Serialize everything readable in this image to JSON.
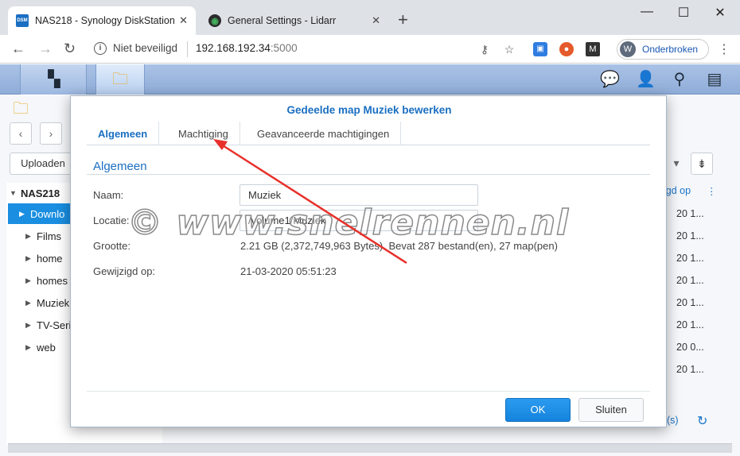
{
  "browser": {
    "tabs": [
      {
        "title": "NAS218 - Synology DiskStation",
        "favicon": "DSM"
      },
      {
        "title": "General Settings - Lidarr"
      }
    ],
    "new_tab": "+",
    "window": {
      "minimize": "—",
      "maximize": "☐",
      "close": "✕"
    },
    "address": {
      "security": "Niet beveiligd",
      "host": "192.168.192.34",
      "port": ":5000"
    },
    "profile": {
      "initial": "W",
      "label": "Onderbroken"
    }
  },
  "filestation": {
    "upload": "Uploaden",
    "tree": [
      {
        "label": "NAS218",
        "root": true
      },
      {
        "label": "Downlo",
        "selected": true
      },
      {
        "label": "Films"
      },
      {
        "label": "home"
      },
      {
        "label": "homes"
      },
      {
        "label": "Muziek"
      },
      {
        "label": "TV-Seri"
      },
      {
        "label": "web"
      }
    ],
    "column_header": "igd op",
    "cells": [
      "20 1...",
      "20 1...",
      "20 1...",
      "20 1...",
      "20 1...",
      "20 1...",
      "20 0...",
      "20 1..."
    ],
    "footer_text": "(s)"
  },
  "dialog": {
    "title": "Gedeelde map Muziek bewerken",
    "tabs": [
      "Algemeen",
      "Machtiging",
      "Geavanceerde machtigingen"
    ],
    "section": "Algemeen",
    "labels": {
      "name": "Naam:",
      "location": "Locatie:",
      "size": "Grootte:",
      "modified": "Gewijzigd op:"
    },
    "values": {
      "name": "Muziek",
      "location": "/volume1/Muziek",
      "size": "2.21 GB (2,372,749,963 Bytes). Bevat 287 bestand(en), 27 map(pen)",
      "modified": "21-03-2020 05:51:23"
    },
    "ok": "OK",
    "close": "Sluiten"
  },
  "watermark": "© www.snelrennen.nl",
  "colors": {
    "accent": "#1a6fc2",
    "selected": "#1a8ee1",
    "annotation": "#e8302a"
  }
}
